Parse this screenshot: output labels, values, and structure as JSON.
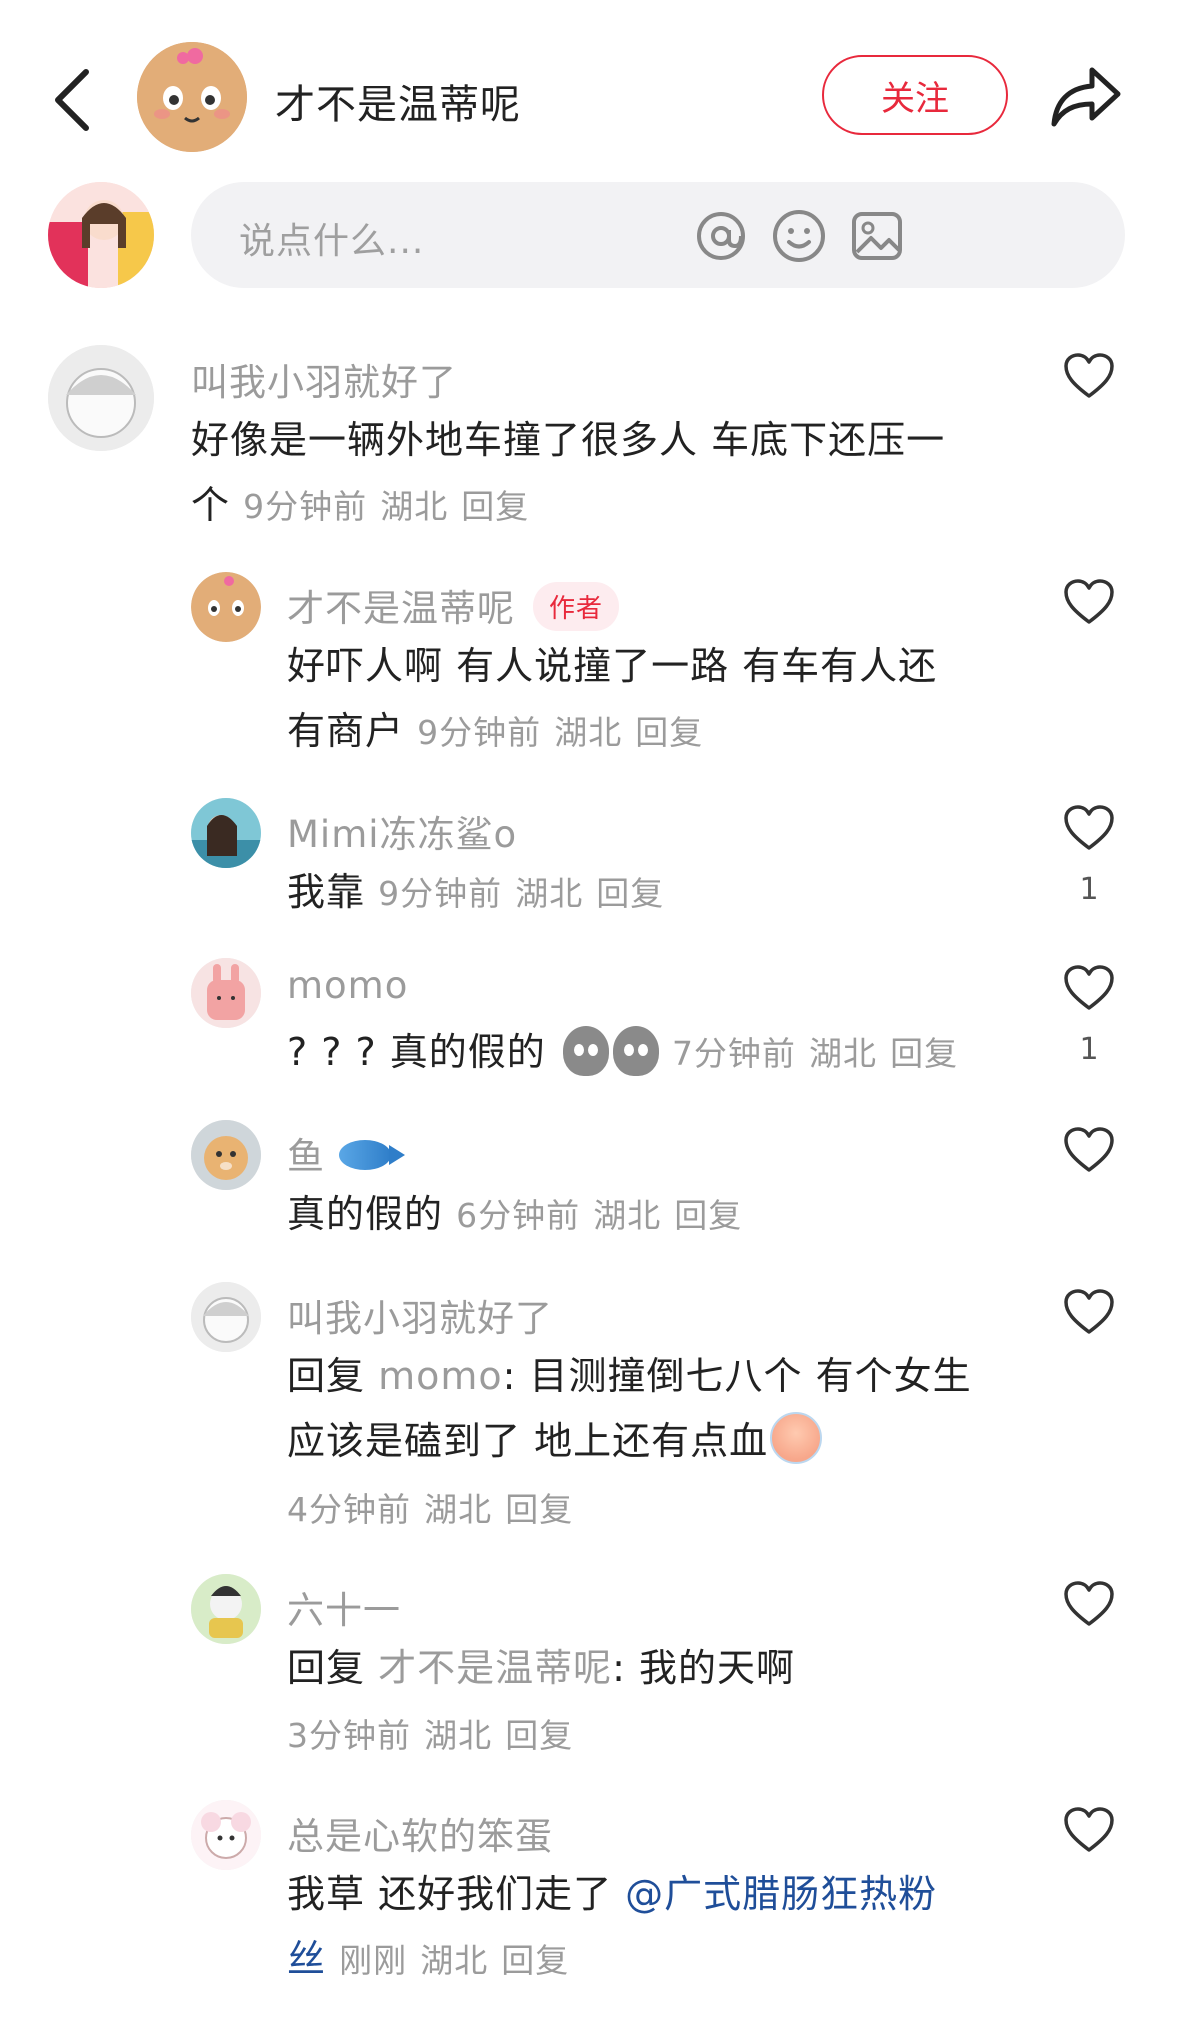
{
  "header": {
    "author_name": "才不是温蒂呢",
    "follow_label": "关注"
  },
  "composer": {
    "placeholder": "说点什么..."
  },
  "comments": [
    {
      "user": "叫我小羽就好了",
      "text_line1": "好像是一辆外地车撞了很多人 车底下还压一",
      "text_line2": "个",
      "time": "9分钟前",
      "location": "湖北",
      "reply": "回复"
    },
    {
      "user": "才不是温蒂呢",
      "badge": "作者",
      "text_line1": "好吓人啊 有人说撞了一路 有车有人还",
      "text_line2": "有商户",
      "time": "9分钟前",
      "location": "湖北",
      "reply": "回复"
    },
    {
      "user": "Mimi冻冻鲨o",
      "text": "我靠",
      "time": "9分钟前",
      "location": "湖北",
      "reply": "回复",
      "likes": "1"
    },
    {
      "user": "momo",
      "text": "? ? ?  真的假的",
      "time": "7分钟前",
      "location": "湖北",
      "reply": "回复",
      "likes": "1"
    },
    {
      "user": "鱼",
      "text": "真的假的",
      "time": "6分钟前",
      "location": "湖北",
      "reply": "回复"
    },
    {
      "user": "叫我小羽就好了",
      "reply_prefix": "回复",
      "reply_to": "momo",
      "text_line1": ": 目测撞倒七八个 有个女生",
      "text_line2": "应该是磕到了 地上还有点血",
      "time": "4分钟前",
      "location": "湖北",
      "reply": "回复"
    },
    {
      "user": "六十一",
      "reply_prefix": "回复",
      "reply_to": "才不是温蒂呢",
      "text": ": 我的天啊",
      "time": "3分钟前",
      "location": "湖北",
      "reply": "回复"
    },
    {
      "user": "总是心软的笨蛋",
      "text_line1": "我草 还好我们走了 ",
      "mention_line1": "@广式腊肠狂热粉",
      "mention_line2": "丝",
      "time": "刚刚",
      "location": "湖北",
      "reply": "回复"
    }
  ],
  "icons": [
    "back-icon",
    "share-icon",
    "at-icon",
    "emoji-icon",
    "image-icon",
    "heart-icon"
  ],
  "colors": {
    "accent": "#e8293c",
    "mention": "#1f4e99",
    "muted": "#9b9b9b"
  }
}
